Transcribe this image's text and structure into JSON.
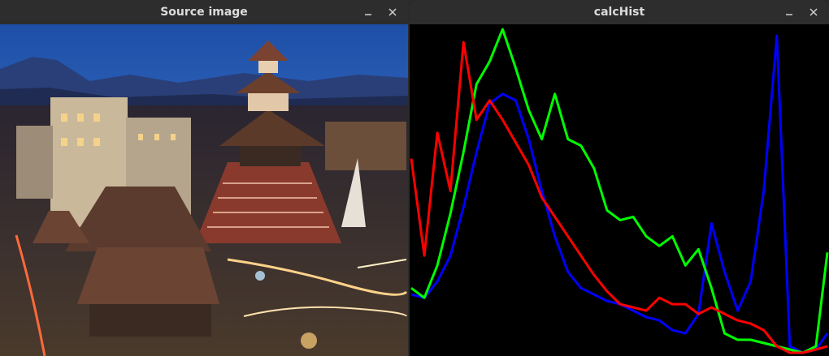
{
  "windows": [
    {
      "title": "Source image",
      "minimize_icon": "minimize-icon",
      "close_icon": "close-icon"
    },
    {
      "title": "calcHist",
      "minimize_icon": "minimize-icon",
      "close_icon": "close-icon"
    }
  ],
  "colors": {
    "titlebar": "#2d2d2d",
    "hist_background": "#000000",
    "blue_channel": "#0000ff",
    "green_channel": "#00ff00",
    "red_channel": "#ff0000"
  },
  "chart_data": {
    "type": "line",
    "xlim": [
      0,
      255
    ],
    "ylim": [
      0,
      1
    ],
    "grid": false,
    "series": [
      {
        "color": "#0000ff",
        "x": [
          0,
          8,
          16,
          24,
          32,
          40,
          48,
          56,
          64,
          72,
          80,
          88,
          96,
          104,
          112,
          120,
          128,
          136,
          144,
          152,
          160,
          168,
          176,
          184,
          192,
          200,
          208,
          216,
          224,
          232,
          240,
          248,
          255
        ],
        "values": [
          0.18,
          0.17,
          0.22,
          0.3,
          0.45,
          0.62,
          0.77,
          0.8,
          0.78,
          0.66,
          0.5,
          0.36,
          0.25,
          0.2,
          0.18,
          0.16,
          0.15,
          0.13,
          0.11,
          0.1,
          0.07,
          0.06,
          0.12,
          0.4,
          0.25,
          0.13,
          0.22,
          0.5,
          0.98,
          0.02,
          0.0,
          0.01,
          0.06
        ]
      },
      {
        "color": "#00ff00",
        "x": [
          0,
          8,
          16,
          24,
          32,
          40,
          48,
          56,
          64,
          72,
          80,
          88,
          96,
          104,
          112,
          120,
          128,
          136,
          144,
          152,
          160,
          168,
          176,
          184,
          192,
          200,
          208,
          216,
          224,
          232,
          240,
          248,
          255
        ],
        "values": [
          0.2,
          0.17,
          0.27,
          0.43,
          0.62,
          0.83,
          0.9,
          1.0,
          0.88,
          0.75,
          0.66,
          0.8,
          0.66,
          0.64,
          0.57,
          0.44,
          0.41,
          0.42,
          0.36,
          0.33,
          0.36,
          0.27,
          0.32,
          0.2,
          0.06,
          0.04,
          0.04,
          0.03,
          0.02,
          0.01,
          0.0,
          0.02,
          0.31
        ]
      },
      {
        "color": "#ff0000",
        "x": [
          0,
          8,
          16,
          24,
          32,
          40,
          48,
          56,
          64,
          72,
          80,
          88,
          96,
          104,
          112,
          120,
          128,
          136,
          144,
          152,
          160,
          168,
          176,
          184,
          192,
          200,
          208,
          216,
          224,
          232,
          240,
          248,
          255
        ],
        "values": [
          0.6,
          0.3,
          0.68,
          0.5,
          0.96,
          0.72,
          0.78,
          0.72,
          0.65,
          0.58,
          0.48,
          0.42,
          0.36,
          0.3,
          0.24,
          0.19,
          0.15,
          0.14,
          0.13,
          0.17,
          0.15,
          0.15,
          0.12,
          0.14,
          0.12,
          0.1,
          0.09,
          0.07,
          0.02,
          0.0,
          0.0,
          0.01,
          0.02
        ]
      }
    ]
  }
}
